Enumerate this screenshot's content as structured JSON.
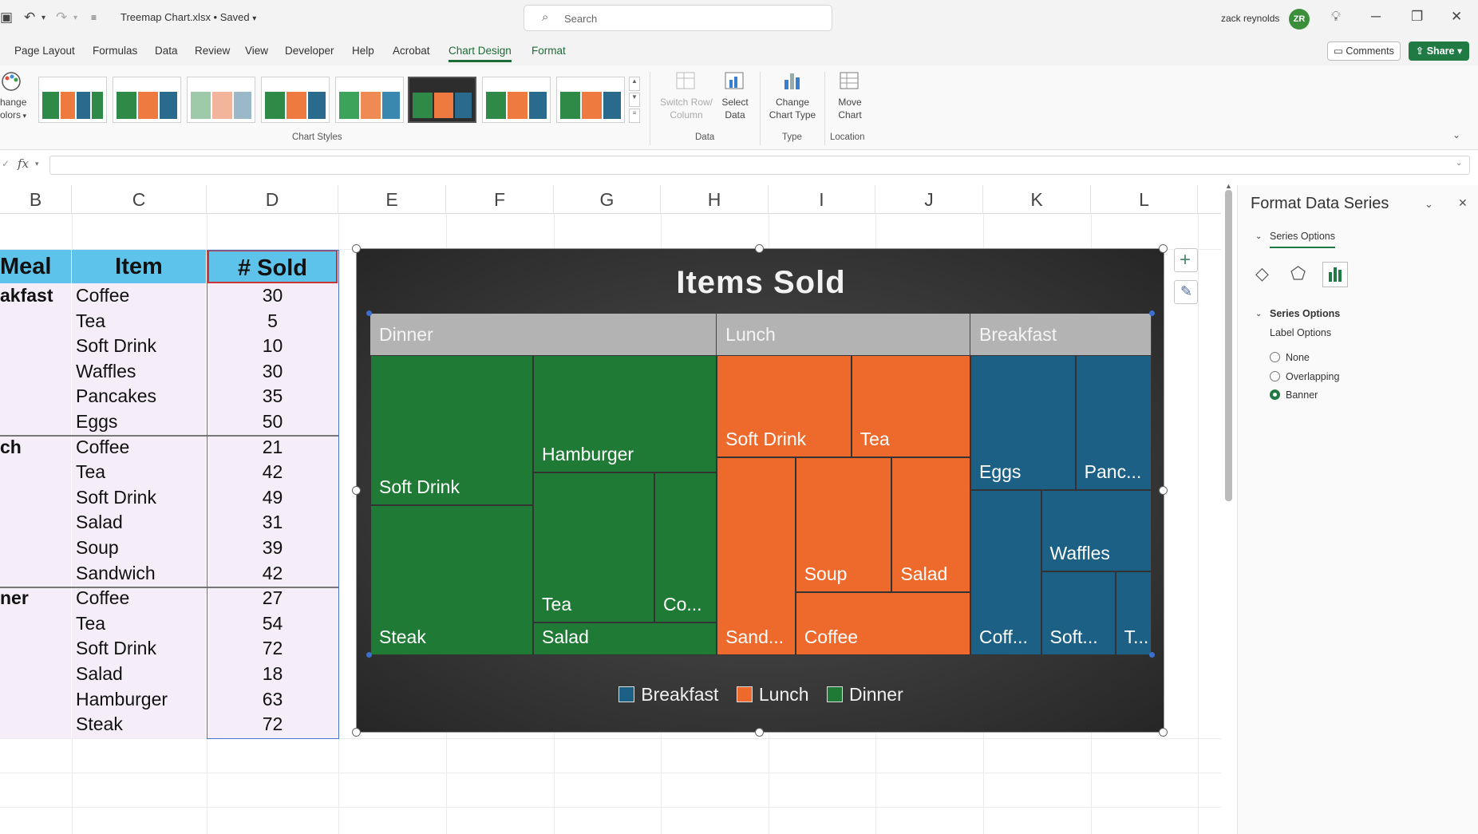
{
  "titlebar": {
    "doc_title": "Treemap Chart.xlsx • Saved",
    "search_placeholder": "Search",
    "user_name": "zack reynolds",
    "avatar_initials": "ZR"
  },
  "menu": {
    "tabs": [
      "Page Layout",
      "Formulas",
      "Data",
      "Review",
      "View",
      "Developer",
      "Help",
      "Acrobat",
      "Chart Design",
      "Format"
    ],
    "active_tab": "Chart Design",
    "comments_label": "Comments",
    "share_label": "Share"
  },
  "ribbon": {
    "change_colors_line1": "hange",
    "change_colors_line2": "olors",
    "chart_styles_group": "Chart Styles",
    "switch_row_line1": "Switch Row/",
    "switch_row_line2": "Column",
    "select_data_line1": "Select",
    "select_data_line2": "Data",
    "data_group": "Data",
    "change_type_line1": "Change",
    "change_type_line2": "Chart Type",
    "type_group": "Type",
    "move_chart_line1": "Move",
    "move_chart_line2": "Chart",
    "location_group": "Location"
  },
  "formula": {
    "fx_label": "fx"
  },
  "columns": [
    "B",
    "C",
    "D",
    "E",
    "F",
    "G",
    "H",
    "I",
    "J",
    "K",
    "L"
  ],
  "table": {
    "headers": {
      "meal": "Meal",
      "item": "Item",
      "sold": "# Sold"
    },
    "rows": [
      {
        "meal": "akfast",
        "item": "Coffee",
        "sold": "30"
      },
      {
        "meal": "",
        "item": "Tea",
        "sold": "5"
      },
      {
        "meal": "",
        "item": "Soft Drink",
        "sold": "10"
      },
      {
        "meal": "",
        "item": "Waffles",
        "sold": "30"
      },
      {
        "meal": "",
        "item": "Pancakes",
        "sold": "35"
      },
      {
        "meal": "",
        "item": "Eggs",
        "sold": "50"
      },
      {
        "meal": "ch",
        "item": "Coffee",
        "sold": "21"
      },
      {
        "meal": "",
        "item": "Tea",
        "sold": "42"
      },
      {
        "meal": "",
        "item": "Soft Drink",
        "sold": "49"
      },
      {
        "meal": "",
        "item": "Salad",
        "sold": "31"
      },
      {
        "meal": "",
        "item": "Soup",
        "sold": "39"
      },
      {
        "meal": "",
        "item": "Sandwich",
        "sold": "42"
      },
      {
        "meal": "ner",
        "item": "Coffee",
        "sold": "27"
      },
      {
        "meal": "",
        "item": "Tea",
        "sold": "54"
      },
      {
        "meal": "",
        "item": "Soft Drink",
        "sold": "72"
      },
      {
        "meal": "",
        "item": "Salad",
        "sold": "18"
      },
      {
        "meal": "",
        "item": "Hamburger",
        "sold": "63"
      },
      {
        "meal": "",
        "item": "Steak",
        "sold": "72"
      }
    ]
  },
  "chart_data": {
    "type": "treemap",
    "title": "Items Sold",
    "colors": {
      "Dinner": "#1f7a35",
      "Lunch": "#ee6a2c",
      "Breakfast": "#1c6185",
      "banner": "#b3b3b3"
    },
    "groups": [
      {
        "name": "Dinner",
        "items": [
          {
            "label": "Soft Drink",
            "value": 72
          },
          {
            "label": "Steak",
            "value": 72
          },
          {
            "label": "Hamburger",
            "value": 63
          },
          {
            "label": "Tea",
            "value": 54
          },
          {
            "label": "Co...",
            "value": 27
          },
          {
            "label": "Salad",
            "value": 18
          }
        ]
      },
      {
        "name": "Lunch",
        "items": [
          {
            "label": "Soft Drink",
            "value": 49
          },
          {
            "label": "Tea",
            "value": 42
          },
          {
            "label": "Sand...",
            "value": 42
          },
          {
            "label": "Soup",
            "value": 39
          },
          {
            "label": "Salad",
            "value": 31
          },
          {
            "label": "Coffee",
            "value": 21
          }
        ]
      },
      {
        "name": "Breakfast",
        "items": [
          {
            "label": "Eggs",
            "value": 50
          },
          {
            "label": "Panc...",
            "value": 35
          },
          {
            "label": "Coff...",
            "value": 30
          },
          {
            "label": "Waffles",
            "value": 30
          },
          {
            "label": "Soft...",
            "value": 10
          },
          {
            "label": "T...",
            "value": 5
          }
        ]
      }
    ],
    "legend": [
      "Breakfast",
      "Lunch",
      "Dinner"
    ],
    "legend_position": "bottom"
  },
  "pane": {
    "title": "Format Data Series",
    "tab_label": "Series Options",
    "section_label": "Series Options",
    "label_options": "Label Options",
    "radio_options": [
      "None",
      "Overlapping",
      "Banner"
    ],
    "selected_option": "Banner"
  }
}
